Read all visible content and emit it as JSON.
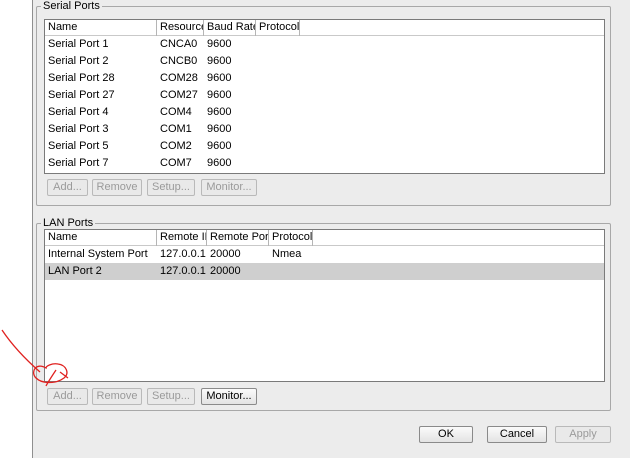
{
  "serial_ports": {
    "title": "Serial Ports",
    "columns": [
      "Name",
      "Resource",
      "Baud Rate",
      "Protocol"
    ],
    "rows": [
      {
        "name": "Serial Port 1",
        "resource": "CNCA0",
        "baud": "9600",
        "protocol": ""
      },
      {
        "name": "Serial Port 2",
        "resource": "CNCB0",
        "baud": "9600",
        "protocol": ""
      },
      {
        "name": "Serial Port 28",
        "resource": "COM28",
        "baud": "9600",
        "protocol": ""
      },
      {
        "name": "Serial Port 27",
        "resource": "COM27",
        "baud": "9600",
        "protocol": ""
      },
      {
        "name": "Serial Port 4",
        "resource": "COM4",
        "baud": "9600",
        "protocol": ""
      },
      {
        "name": "Serial Port 3",
        "resource": "COM1",
        "baud": "9600",
        "protocol": ""
      },
      {
        "name": "Serial Port 5",
        "resource": "COM2",
        "baud": "9600",
        "protocol": ""
      },
      {
        "name": "Serial Port 7",
        "resource": "COM7",
        "baud": "9600",
        "protocol": ""
      }
    ],
    "buttons": {
      "add": "Add...",
      "remove": "Remove",
      "setup": "Setup...",
      "monitor": "Monitor..."
    }
  },
  "lan_ports": {
    "title": "LAN Ports",
    "columns": [
      "Name",
      "Remote IP",
      "Remote Port",
      "Protocol"
    ],
    "rows": [
      {
        "name": "Internal System Port",
        "ip": "127.0.0.1",
        "port": "20000",
        "protocol": "Nmea"
      },
      {
        "name": "LAN Port 2",
        "ip": "127.0.0.1",
        "port": "20000",
        "protocol": ""
      }
    ],
    "selected_row": 1,
    "buttons": {
      "add": "Add...",
      "remove": "Remove",
      "setup": "Setup...",
      "monitor": "Monitor..."
    }
  },
  "dialog_buttons": {
    "ok": "OK",
    "cancel": "Cancel",
    "apply": "Apply"
  },
  "colors": {
    "dialog_bg": "#ececec",
    "selection": "#cfcfcf",
    "annotation_red": "#e0211f"
  }
}
